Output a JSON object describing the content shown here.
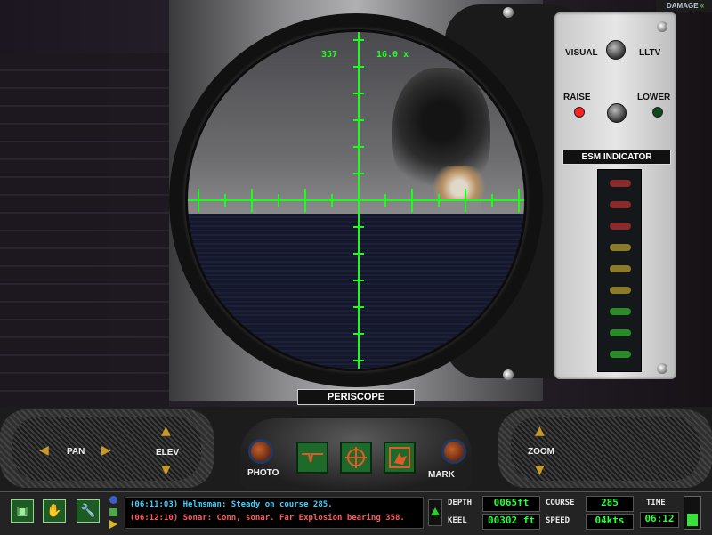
{
  "damage_label": "DAMAGE",
  "reticle": {
    "bearing": "357",
    "magnification": "16.0 x"
  },
  "panel": {
    "visual_label": "VISUAL",
    "lltv_label": "LLTV",
    "raise_label": "RAISE",
    "lower_label": "LOWER",
    "esm_title": "ESM INDICATOR",
    "esm_led_colors": [
      "#8a2a2a",
      "#8a2a2a",
      "#8a2a2a",
      "#8a7a2a",
      "#8a7a2a",
      "#8a7a2a",
      "#2a8a2a",
      "#2a8a2a",
      "#2a8a2a"
    ],
    "raise_led_color": "#ff2020",
    "lower_led_color": "#0c4a1c"
  },
  "periscope_label": "PERISCOPE",
  "controls": {
    "pan_label": "PAN",
    "elev_label": "ELEV",
    "photo_label": "PHOTO",
    "mark_label": "MARK",
    "zoom_label": "ZOOM"
  },
  "messages": [
    {
      "text": "(06:11:03) Helmsman: Steady on course 285.",
      "color": "#3fd0ff"
    },
    {
      "text": "(06:12:10) Sonar: Conn, sonar. Far Explosion bearing 358.",
      "color": "#ff5a5a"
    }
  ],
  "readouts": {
    "depth_label": "DEPTH",
    "depth_value": "0065ft",
    "keel_label": "KEEL",
    "keel_value": "00302 ft",
    "course_label": "COURSE",
    "course_value": "285",
    "speed_label": "SPEED",
    "speed_value": "04kts",
    "time_label": "TIME",
    "time_value": "06:12"
  },
  "icons": [
    "window-icon",
    "hand-icon",
    "wrench-icon"
  ]
}
